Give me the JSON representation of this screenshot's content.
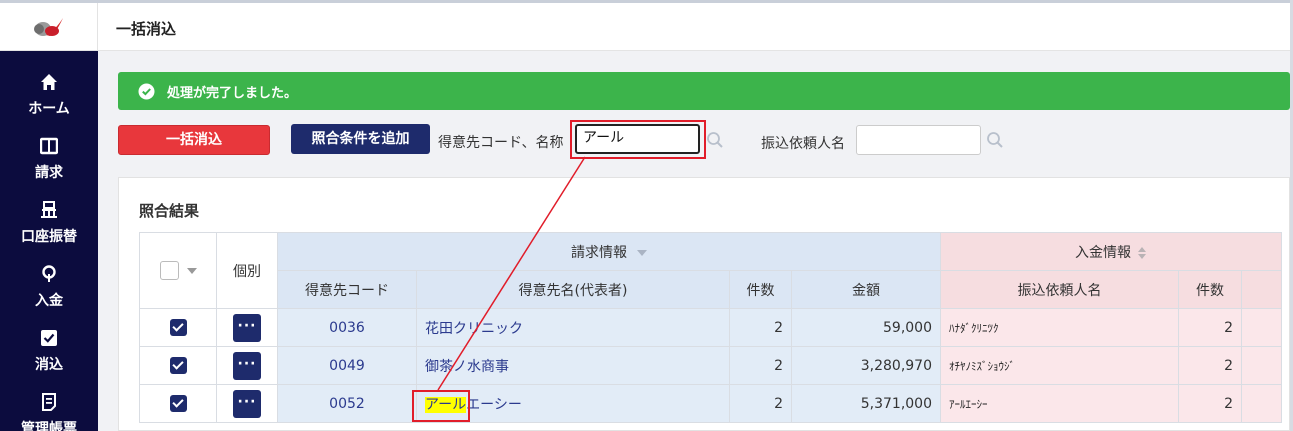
{
  "header": {
    "title": "一括消込"
  },
  "sidebar": {
    "items": [
      {
        "label": "ホーム",
        "icon": "home-icon"
      },
      {
        "label": "請求",
        "icon": "book-icon"
      },
      {
        "label": "口座振替",
        "icon": "bank-icon"
      },
      {
        "label": "入金",
        "icon": "deposit-icon"
      },
      {
        "label": "消込",
        "icon": "checkbox-icon"
      },
      {
        "label": "管理帳票",
        "icon": "report-icon"
      }
    ]
  },
  "alert": {
    "message": "処理が完了しました。",
    "icon": "check-circle-icon"
  },
  "toolbar": {
    "bulk_button": "一括消込",
    "add_condition_button": "照合条件を追加",
    "customer_label": "得意先コード、名称",
    "customer_value": "アール",
    "payer_label": "振込依頼人名",
    "payer_value": ""
  },
  "results": {
    "title": "照合結果",
    "col_individual": "個別",
    "group_invoice": "請求情報",
    "group_deposit": "入金情報",
    "columns": {
      "customer_code": "得意先コード",
      "customer_name": "得意先名(代表者)",
      "count": "件数",
      "amount": "金額",
      "payer_name": "振込依頼人名",
      "deposit_count": "件数"
    },
    "rows": [
      {
        "code": "0036",
        "name": "花田クリニック",
        "count": "2",
        "amount": "59,000",
        "payer": "ﾊﾅﾀﾞｸﾘﾆﾂｸ",
        "dep_count": "2"
      },
      {
        "code": "0049",
        "name": "御茶ノ水商事",
        "count": "2",
        "amount": "3,280,970",
        "payer": "ｵﾁﾔﾉﾐｽﾞｼｮｳｼﾞ",
        "dep_count": "2"
      },
      {
        "code": "0052",
        "name_highlight": "アール",
        "name_rest": "エーシー",
        "count": "2",
        "amount": "5,371,000",
        "payer": "ｱｰﾙｴｰｼｰ",
        "dep_count": "2"
      }
    ]
  },
  "colors": {
    "sidebar": "#0c0c3e",
    "success": "#3cb44b",
    "danger": "#e8373c",
    "navy": "#1e2b6c",
    "annotation": "#e11d2a",
    "highlight": "#ffff00"
  }
}
